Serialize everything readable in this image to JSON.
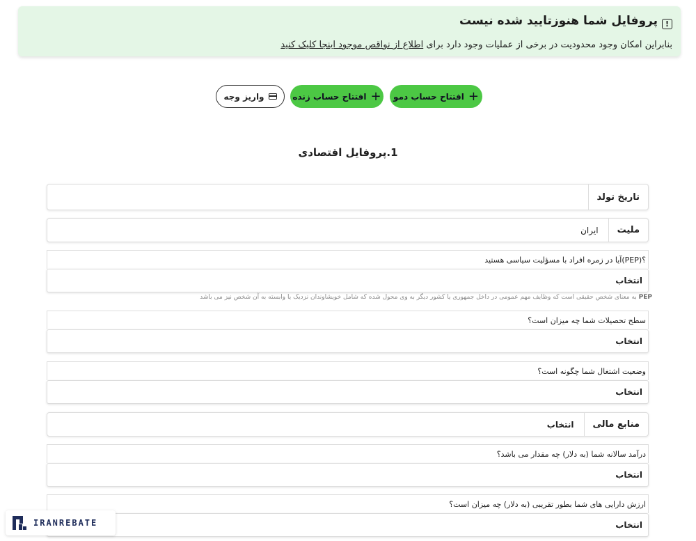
{
  "alert": {
    "title": "پروفایل شما هنوزتایید شده نیست",
    "icon": "exclamation-icon",
    "text_before": "بنابراین امکان وجود محدودیت در برخی از عملیات وجود دارد برای ",
    "link_text": "اطلاع از نواقص موجود اینجا کلیک کنید"
  },
  "actions": {
    "demo_label": "افتتاح حساب دمو",
    "live_label": "افتتاح حساب زنده",
    "deposit_label": "واریز وجه"
  },
  "section": {
    "title": "1.پروفایل اقتصادی"
  },
  "fields": {
    "birthdate": {
      "label": "تاریخ تولد",
      "value": ""
    },
    "nationality": {
      "label": "ملیت",
      "value": "ایران"
    },
    "pep": {
      "question": "؟(PEP)آیا در زمره افراد با مسؤلیت سیاسی هستید",
      "value": "انتخاب"
    },
    "pep_note": {
      "term": "PEP",
      "text": " به معنای شخص حقیقی است که وظایف مهم عمومی در داخل جمهوری یا کشور دیگر به وی محول شده که شامل خویشاوندان نزدیک یا وابسته به آن شخص نیز می باشد"
    },
    "education": {
      "question": "سطح تحصیلات شما چه میزان است؟",
      "value": "انتخاب"
    },
    "employment": {
      "question": "وضعیت اشتغال شما چگونه است؟",
      "value": "انتخاب"
    },
    "funds": {
      "label": "منابع مالی",
      "value": "انتخاب"
    },
    "income": {
      "question": "درآمد سالانه شما (به دلار) چه مقدار می باشد؟",
      "value": "انتخاب"
    },
    "assets": {
      "question": "ارزش دارایی های شما بطور تقریبی (به دلار) چه میزان است؟",
      "value": "انتخاب"
    }
  },
  "watermark": {
    "text": "IRANREBATE"
  },
  "colors": {
    "alert_bg": "#e4f6e6",
    "accent_green": "#4cc844",
    "brand_navy": "#1e2c5a"
  }
}
